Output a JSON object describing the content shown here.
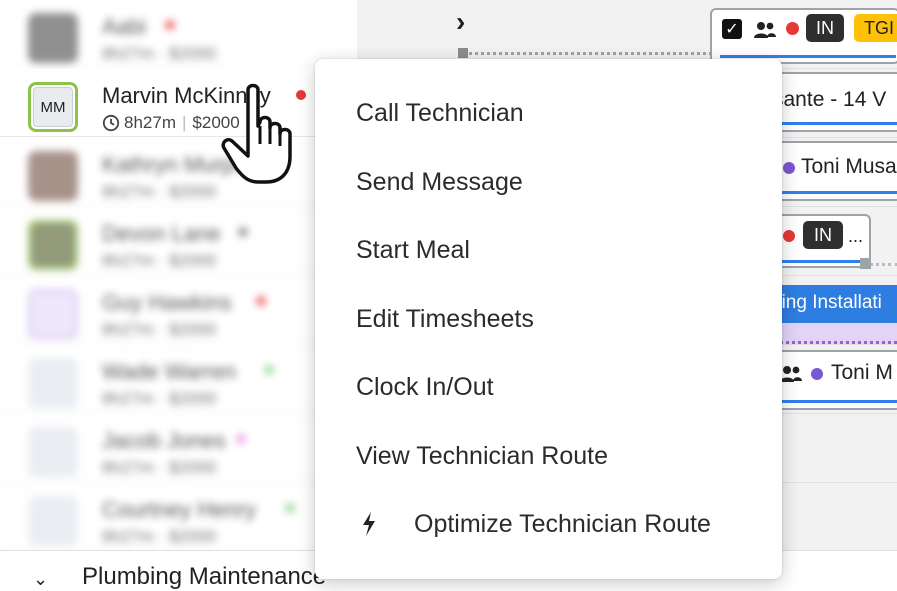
{
  "technicians": [
    {
      "name": "Aabi",
      "meta": "8h27m · $2000",
      "dot": "#e53935"
    },
    {
      "name": "Marvin McKinney",
      "initials": "MM",
      "time": "8h27m",
      "amount": "$2000",
      "dot": "#e53935"
    },
    {
      "name": "Kathryn Murphy",
      "meta": "8h27m · $2000",
      "dot": "#e53935"
    },
    {
      "name": "Devon Lane",
      "meta": "8h27m · $2000",
      "dot": "#777777"
    },
    {
      "name": "Guy Hawkins",
      "meta": "8h27m · $2000",
      "dot": "#e53935"
    },
    {
      "name": "Wade Warren",
      "meta": "8h27m · $2000",
      "dot": "#7ccf7c"
    },
    {
      "name": "Jacob Jones",
      "meta": "8h27m · $2000",
      "dot": "#e78be0"
    },
    {
      "name": "Courtney Henry",
      "meta": "8h27m · $2000",
      "dot": "#7ccf7c"
    }
  ],
  "timeline": {
    "chevron": "›",
    "top_card": {
      "status": "IN",
      "tag": "TGI"
    },
    "job2_text": "sante - 14 V",
    "job3_text": "Toni Musa",
    "mid_card": {
      "status": "IN",
      "more": "..."
    },
    "job5_text": "hing Installati",
    "job6_text": "Toni M"
  },
  "context_menu": {
    "items": [
      {
        "label": "Call Technician"
      },
      {
        "label": "Send Message"
      },
      {
        "label": "Start Meal"
      },
      {
        "label": "Edit Timesheets"
      },
      {
        "label": "Clock In/Out"
      },
      {
        "label": "View Technician Route"
      },
      {
        "label": "Optimize Technician Route",
        "icon": "lightning-bolt-icon"
      }
    ]
  },
  "group": {
    "chevron": "⌄",
    "label": "Plumbing Maintenance"
  },
  "colors": {
    "active_border": "#8cc34a",
    "status_dark": "#2f2f2f",
    "tag_yellow": "#ffc107",
    "accent_blue": "#2f80ed",
    "job_purple_bg": "#e3d4f7",
    "job_blue": "#2e7de0",
    "red_dot": "#e53935",
    "purple_dot": "#7b57d1"
  }
}
